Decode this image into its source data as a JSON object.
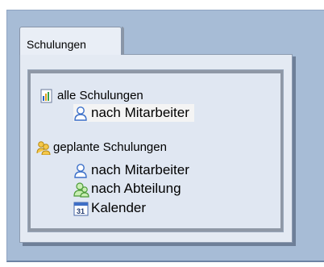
{
  "tab": {
    "label": "Schulungen"
  },
  "tree": [
    {
      "label": "alle Schulungen",
      "icon": "document-chart-icon"
    },
    {
      "label": "nach Mitarbeiter",
      "icon": "person-icon"
    },
    {
      "label": "geplante Schulungen",
      "icon": "people-group-icon"
    },
    {
      "label": "nach Mitarbeiter",
      "icon": "person-icon"
    },
    {
      "label": "nach Abteilung",
      "icon": "department-icon"
    },
    {
      "label": "Kalender",
      "icon": "calendar-icon"
    }
  ]
}
